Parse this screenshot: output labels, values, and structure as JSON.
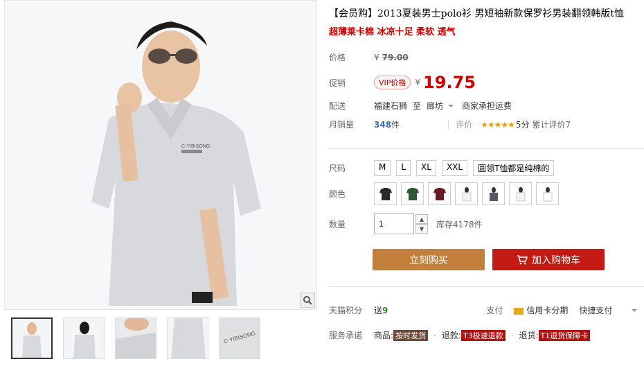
{
  "product": {
    "title": "【会员购】2013夏装男士polo衫 男短袖新款保罗衫男装翻领韩版t恤",
    "subtitle": "超薄莱卡棉 冰凉十足 柔软 透气"
  },
  "price": {
    "label": "价格",
    "currency": "¥",
    "original": "79.00"
  },
  "promo": {
    "label": "促销",
    "badge": "VIP价格",
    "currency": "¥",
    "price": "19.75"
  },
  "shipping": {
    "label": "配送",
    "from": "福建石狮",
    "to_word": "至",
    "to": "廊坊",
    "note": "商家承担运费"
  },
  "sales": {
    "label": "月销量",
    "count": "348",
    "unit": "件",
    "rating_label": "评价",
    "stars": "★★★★★",
    "score": "5分",
    "review_count": "累计评价7"
  },
  "options": {
    "size_label": "尺码",
    "sizes": [
      "M",
      "L",
      "XL",
      "XXL",
      "圆领T恤都是纯棉的"
    ],
    "color_label": "颜色",
    "color_count": 7,
    "colors": [
      "#2a2a2a",
      "#2f5a3a",
      "#6a1a22",
      "#f2f2f2",
      "#555a60",
      "#f4f4f4",
      "#ffffff"
    ],
    "qty_label": "数量",
    "qty_value": "1",
    "stock": "库存4178件"
  },
  "actions": {
    "buy_now": "立刻购买",
    "add_cart": "加入购物车"
  },
  "points": {
    "label": "天猫积分",
    "send": "送",
    "value": "9",
    "pay_label": "支付",
    "credit": "信用卡分期",
    "quick_pay": "快捷支付"
  },
  "service": {
    "label": "服务承诺",
    "goods_label": "商品:",
    "goods_tag": "按时发货",
    "refund_label": "退款:",
    "refund_tag": "T3极速退款",
    "return_label": "退货:",
    "return_tag": "T1退货保障卡"
  },
  "colors_ui": {
    "accent_red": "#c00000",
    "buy_orange": "#c3803c",
    "cart_red": "#c31b13"
  }
}
